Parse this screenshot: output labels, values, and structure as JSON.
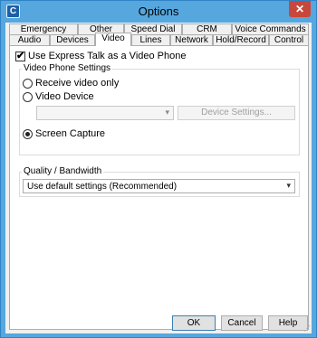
{
  "window": {
    "title": "Options",
    "close_glyph": "✕",
    "app_icon": "C"
  },
  "tabs": {
    "row_back": [
      "Emergency",
      "Other",
      "Speed Dial",
      "CRM",
      "Voice Commands"
    ],
    "row_front": [
      "Audio",
      "Devices",
      "Video",
      "Lines",
      "Network",
      "Hold/Record",
      "Control"
    ],
    "active": "Video"
  },
  "video": {
    "use_as_phone": {
      "label": "Use Express Talk as a Video Phone",
      "checked": true
    },
    "settings_group": {
      "legend": "Video Phone Settings",
      "receive_only_label": "Receive video only",
      "video_device_label": "Video Device",
      "device_select_value": "",
      "device_settings_label": "Device Settings...",
      "screen_capture_label": "Screen Capture",
      "selected": "Screen Capture"
    },
    "quality_group": {
      "legend": "Quality / Bandwidth",
      "value": "Use default settings (Recommended)"
    }
  },
  "footer": {
    "ok": "OK",
    "cancel": "Cancel",
    "help": "Help"
  },
  "icons": {
    "checkmark": "✔",
    "dropdown": "▾",
    "grip": "⋰"
  }
}
